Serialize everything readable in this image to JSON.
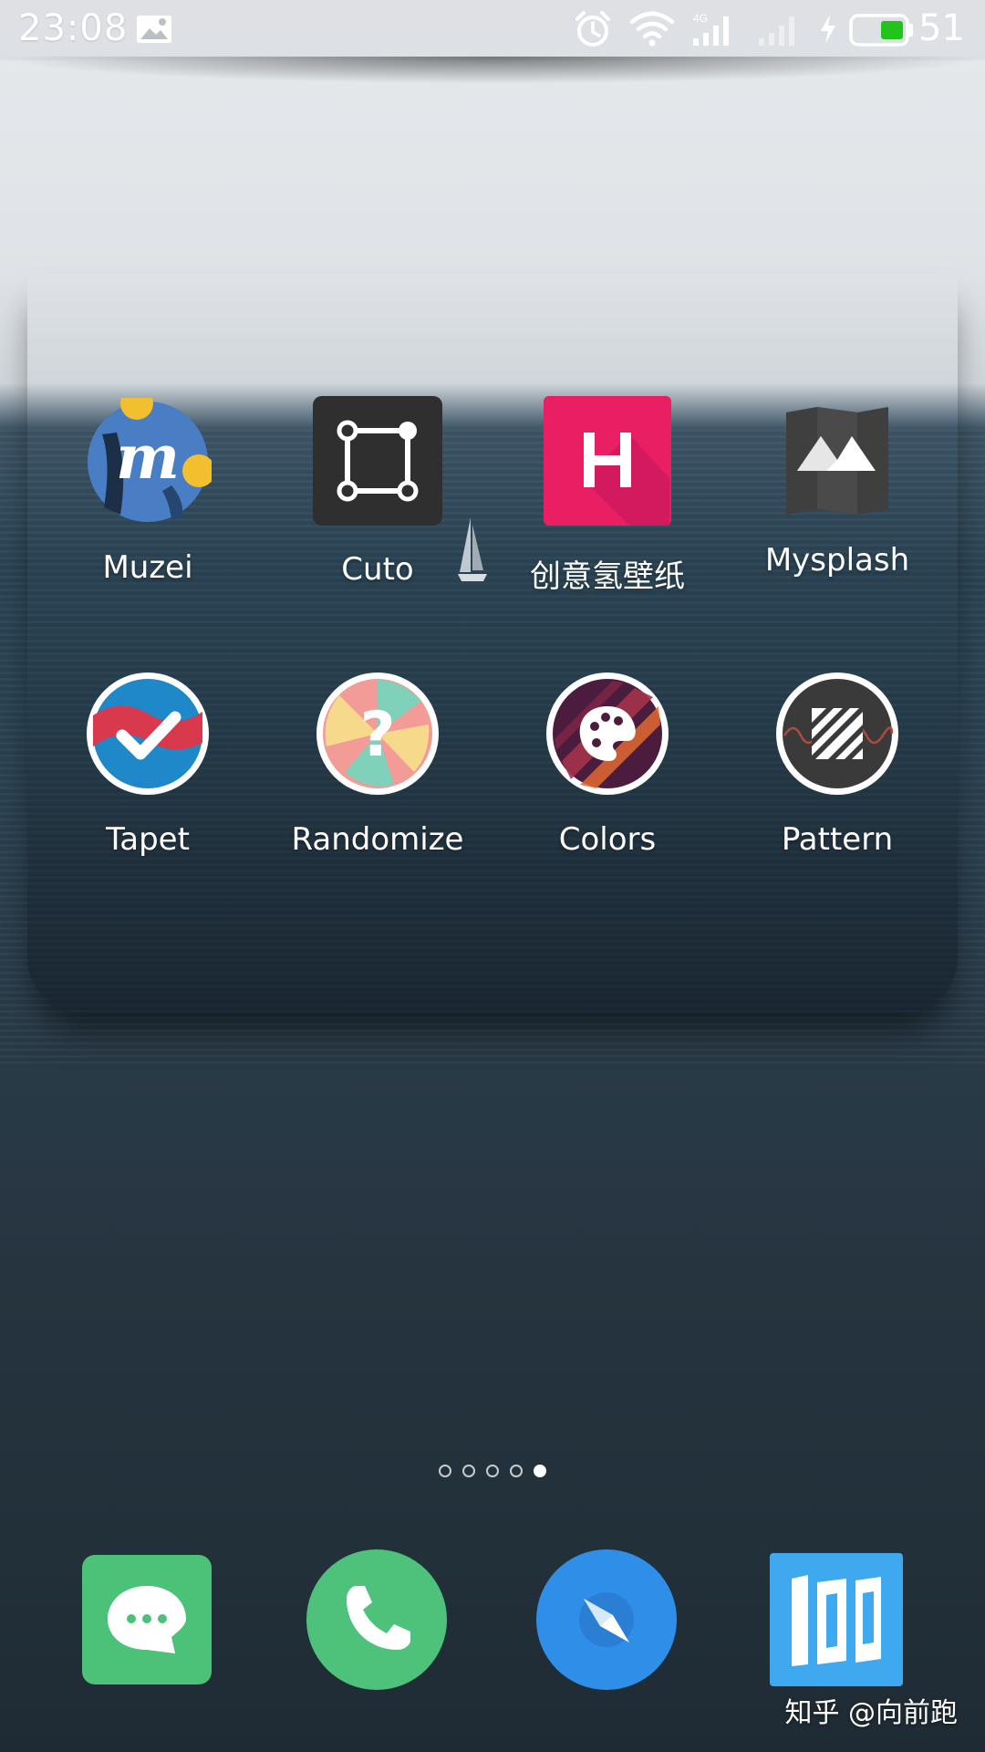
{
  "status_bar": {
    "time": "23:08",
    "battery_level": "51",
    "icons": [
      "image-notification-icon",
      "alarm-icon",
      "wifi-icon",
      "signal-4g-icon",
      "signal-icon",
      "charging-icon",
      "battery-icon"
    ],
    "network_label": "4G",
    "battery_color": "#22c41c"
  },
  "folder": {
    "apps": [
      {
        "label": "Muzei",
        "icon": "muzei-icon"
      },
      {
        "label": "Cuto",
        "icon": "cuto-icon"
      },
      {
        "label": "创意氢壁纸",
        "icon": "hydrogen-wallpaper-icon"
      },
      {
        "label": "Mysplash",
        "icon": "mysplash-icon"
      },
      {
        "label": "Tapet",
        "icon": "tapet-icon"
      },
      {
        "label": "Randomize",
        "icon": "randomize-icon"
      },
      {
        "label": "Colors",
        "icon": "colors-icon"
      },
      {
        "label": "Pattern",
        "icon": "pattern-icon"
      }
    ]
  },
  "pager": {
    "total": 5,
    "current": 5
  },
  "dock": {
    "apps": [
      {
        "icon": "messages-icon",
        "color": "#4cc279"
      },
      {
        "icon": "phone-icon",
        "color": "#4ec27a"
      },
      {
        "icon": "browser-compass-icon",
        "color": "#2f8ee8"
      },
      {
        "icon": "app-store-icon",
        "color": "#3fa9f0"
      }
    ]
  },
  "watermark": "知乎 @向前跑"
}
